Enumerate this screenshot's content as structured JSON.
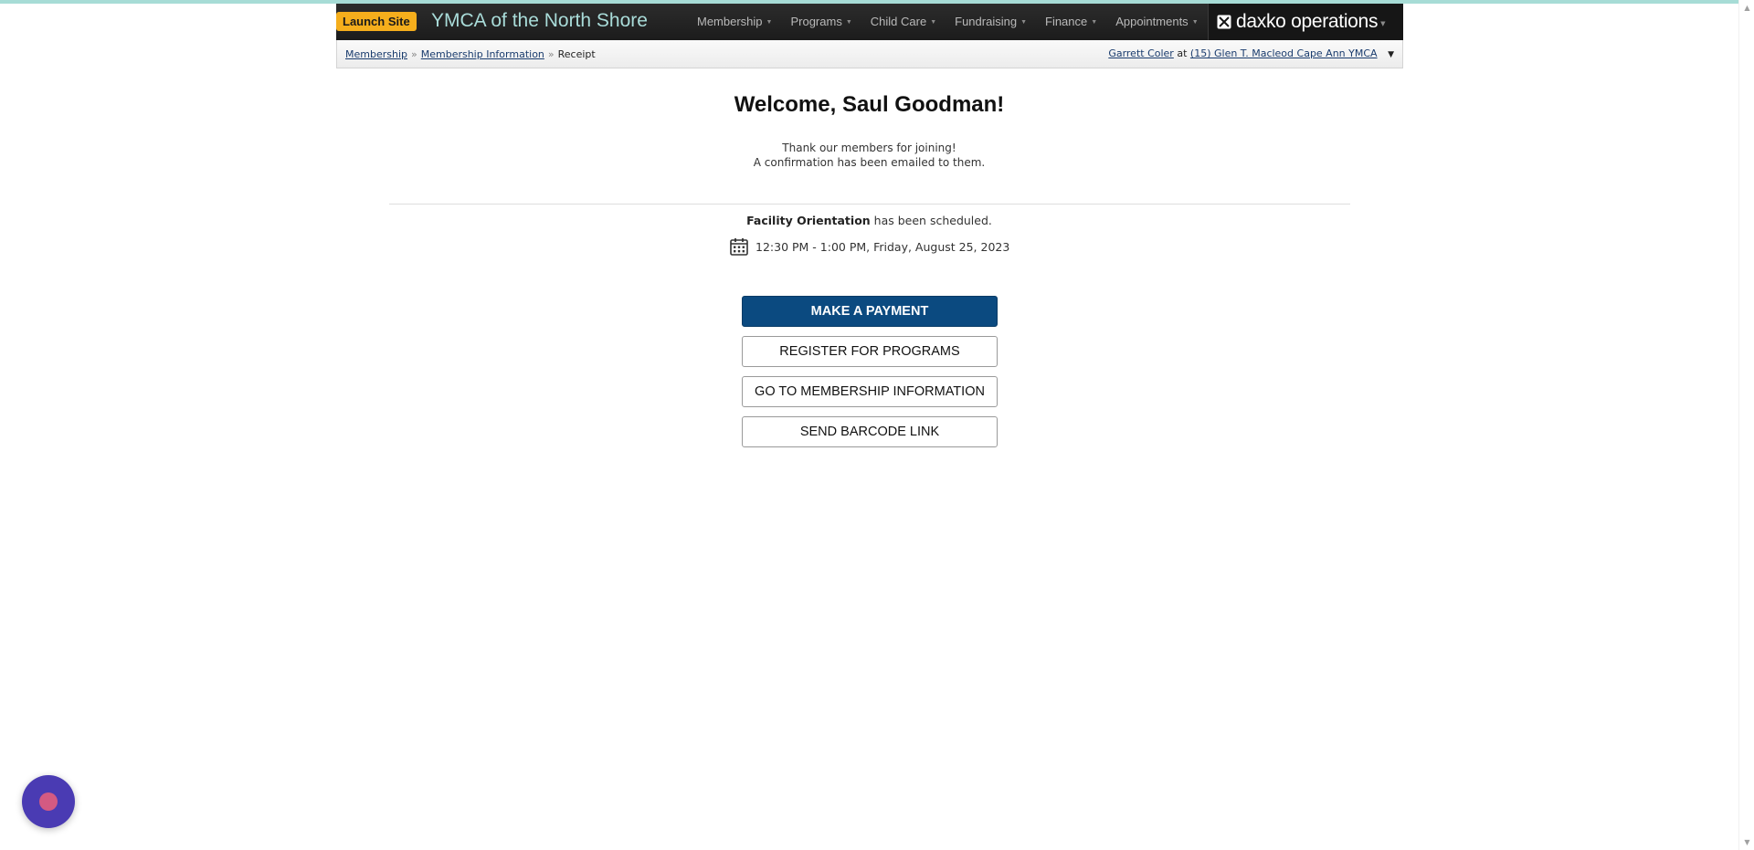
{
  "colors": {
    "top_strip": "#a7dcd6",
    "launch_button_bg": "#f5ae1c",
    "org_name": "#a9dcd9",
    "navbar_bg": "#222222",
    "primary_button_bg": "#0b4a80",
    "chat_bubble_bg": "#4a3bb3",
    "chat_dot": "#d45a82"
  },
  "navbar": {
    "launch_label": "Launch Site",
    "org_name": "YMCA of the North Shore",
    "menu": [
      {
        "label": "Membership"
      },
      {
        "label": "Programs"
      },
      {
        "label": "Child Care"
      },
      {
        "label": "Fundraising"
      },
      {
        "label": "Finance"
      },
      {
        "label": "Appointments"
      }
    ],
    "brand_icon": "envelope-x-icon",
    "brand_text": "daxko operations"
  },
  "breadcrumb": {
    "items": [
      {
        "label": "Membership"
      },
      {
        "label": "Membership Information"
      }
    ],
    "separator": "»",
    "current": "Receipt"
  },
  "user": {
    "name": "Garrett Coler",
    "at": "at",
    "location": "(15) Glen T. Macleod Cape Ann YMCA"
  },
  "main": {
    "welcome": "Welcome, Saul Goodman!",
    "thanks_line1": "Thank our members for joining!",
    "thanks_line2": "A confirmation has been emailed to them.",
    "orientation_title": "Facility Orientation",
    "orientation_suffix": "has been scheduled.",
    "schedule_icon": "calendar-icon",
    "schedule_time": "12:30 PM - 1:00 PM, Friday, August 25, 2023"
  },
  "actions": {
    "make_payment": "MAKE A PAYMENT",
    "register_programs": "REGISTER FOR PROGRAMS",
    "go_membership": "GO TO MEMBERSHIP INFORMATION",
    "send_barcode": "SEND BARCODE LINK"
  },
  "chat": {
    "icon": "chat-bubble-icon"
  }
}
